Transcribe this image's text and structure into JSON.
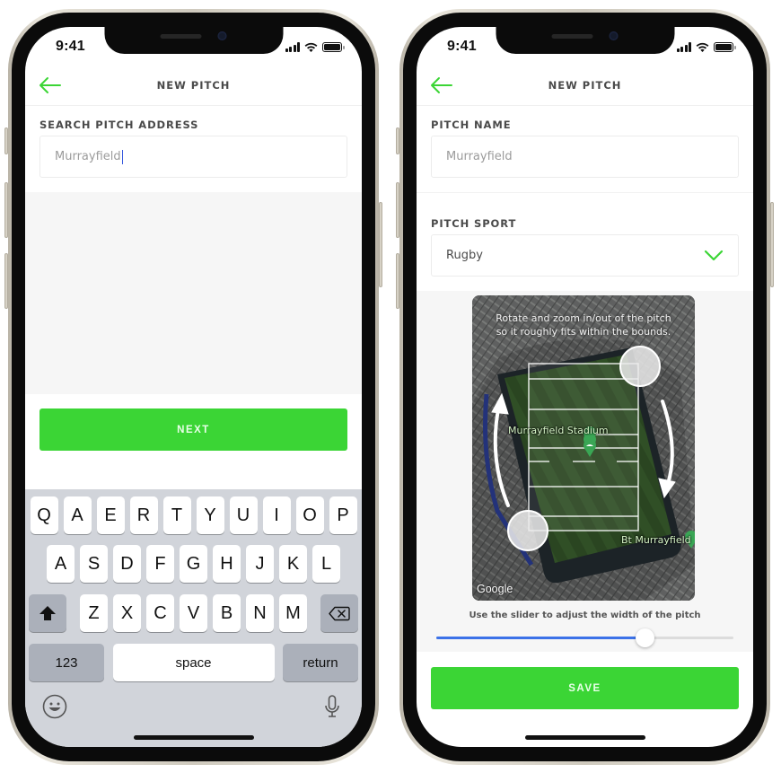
{
  "colors": {
    "accent_green": "#3bd535",
    "slider_blue": "#3c72e8",
    "text_dark": "#4a4a4a",
    "placeholder_grey": "#9b9b9b"
  },
  "status_bar": {
    "time": "9:41"
  },
  "left_screen": {
    "header": {
      "title": "NEW PITCH",
      "back_icon": "arrow-left-icon"
    },
    "search": {
      "label": "SEARCH PITCH ADDRESS",
      "value": "Murrayfield"
    },
    "next_button": "NEXT",
    "keyboard": {
      "row1": [
        "Q",
        "A",
        "E",
        "R",
        "T",
        "Y",
        "U",
        "I",
        "O",
        "P"
      ],
      "row2": [
        "A",
        "S",
        "D",
        "F",
        "G",
        "H",
        "J",
        "K",
        "L"
      ],
      "row3": [
        "Z",
        "X",
        "C",
        "V",
        "B",
        "N",
        "M"
      ],
      "shift_icon": "shift-arrow-icon",
      "delete_icon": "backspace-icon",
      "numbers_label": "123",
      "space_label": "space",
      "return_label": "return",
      "emoji_icon": "emoji-icon",
      "mic_icon": "microphone-icon"
    }
  },
  "right_screen": {
    "header": {
      "title": "NEW PITCH",
      "back_icon": "arrow-left-icon"
    },
    "pitch_name": {
      "label": "PITCH NAME",
      "value": "Murrayfield"
    },
    "pitch_sport": {
      "label": "PITCH SPORT",
      "value": "Rugby",
      "icon": "chevron-down-icon"
    },
    "map": {
      "hint_line1": "Rotate and zoom in/out of the pitch",
      "hint_line2": "so it roughly fits within the bounds.",
      "place_label": "Murrayfield Stadium",
      "secondary_label": "Bt Murrayfield",
      "attribution": "Google"
    },
    "slider": {
      "label": "Use the slider to adjust the width of the pitch",
      "value_percent": 70
    },
    "save_button": "SAVE"
  }
}
